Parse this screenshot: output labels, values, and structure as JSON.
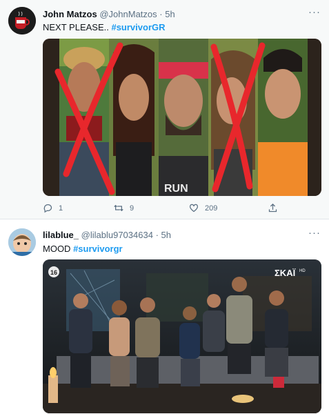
{
  "tweets": [
    {
      "name": "John Matzos",
      "handle": "@JohnMatzos",
      "separator": "·",
      "time": "5h",
      "text": "NEXT PLEASE.. ",
      "hashtag": "#survivorGR",
      "more_icon": "more-horizontal-icon",
      "shirt_text": "RUN",
      "actions": {
        "replies": "1",
        "retweets": "9",
        "likes": "209"
      }
    },
    {
      "name": "lilablue_",
      "handle": "@lilablu97034634",
      "separator": "·",
      "time": "5h",
      "text": "MOOD ",
      "hashtag": "#survivorgr",
      "more_icon": "more-horizontal-icon",
      "channel_logo": "ΣΚΑΪ",
      "channel_sub": "HD",
      "age_rating": "16"
    }
  ],
  "colors": {
    "hashtag": "#1d9bf0",
    "meta": "#5b7083",
    "cross": "#e8272c",
    "tweet1_bg": "#f7f9f9"
  }
}
